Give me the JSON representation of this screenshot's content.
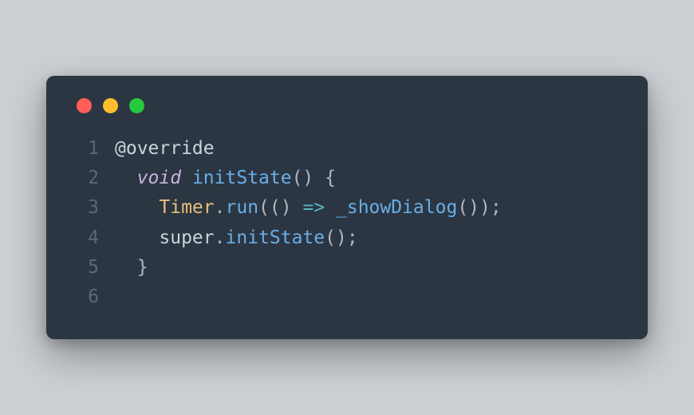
{
  "traffic_lights": {
    "red": "#ff5f56",
    "yellow": "#ffbd2e",
    "green": "#27c93f"
  },
  "code": {
    "lines": [
      {
        "num": "1",
        "indent": "",
        "tokens": [
          {
            "t": "@override",
            "c": "annotation"
          }
        ]
      },
      {
        "num": "2",
        "indent": "  ",
        "tokens": [
          {
            "t": "void",
            "c": "keyword"
          },
          {
            "t": " ",
            "c": "default"
          },
          {
            "t": "initState",
            "c": "method"
          },
          {
            "t": "() {",
            "c": "punct"
          }
        ]
      },
      {
        "num": "3",
        "indent": "    ",
        "tokens": [
          {
            "t": "Timer",
            "c": "type"
          },
          {
            "t": ".",
            "c": "punct"
          },
          {
            "t": "run",
            "c": "method"
          },
          {
            "t": "(() ",
            "c": "punct"
          },
          {
            "t": "=>",
            "c": "punct2"
          },
          {
            "t": " ",
            "c": "default"
          },
          {
            "t": "_showDialog",
            "c": "method"
          },
          {
            "t": "());",
            "c": "punct"
          }
        ]
      },
      {
        "num": "4",
        "indent": "    ",
        "tokens": [
          {
            "t": "super",
            "c": "default"
          },
          {
            "t": ".",
            "c": "punct"
          },
          {
            "t": "initState",
            "c": "method"
          },
          {
            "t": "();",
            "c": "punct"
          }
        ]
      },
      {
        "num": "5",
        "indent": "  ",
        "tokens": [
          {
            "t": "}",
            "c": "punct"
          }
        ]
      },
      {
        "num": "6",
        "indent": "",
        "tokens": []
      }
    ]
  }
}
